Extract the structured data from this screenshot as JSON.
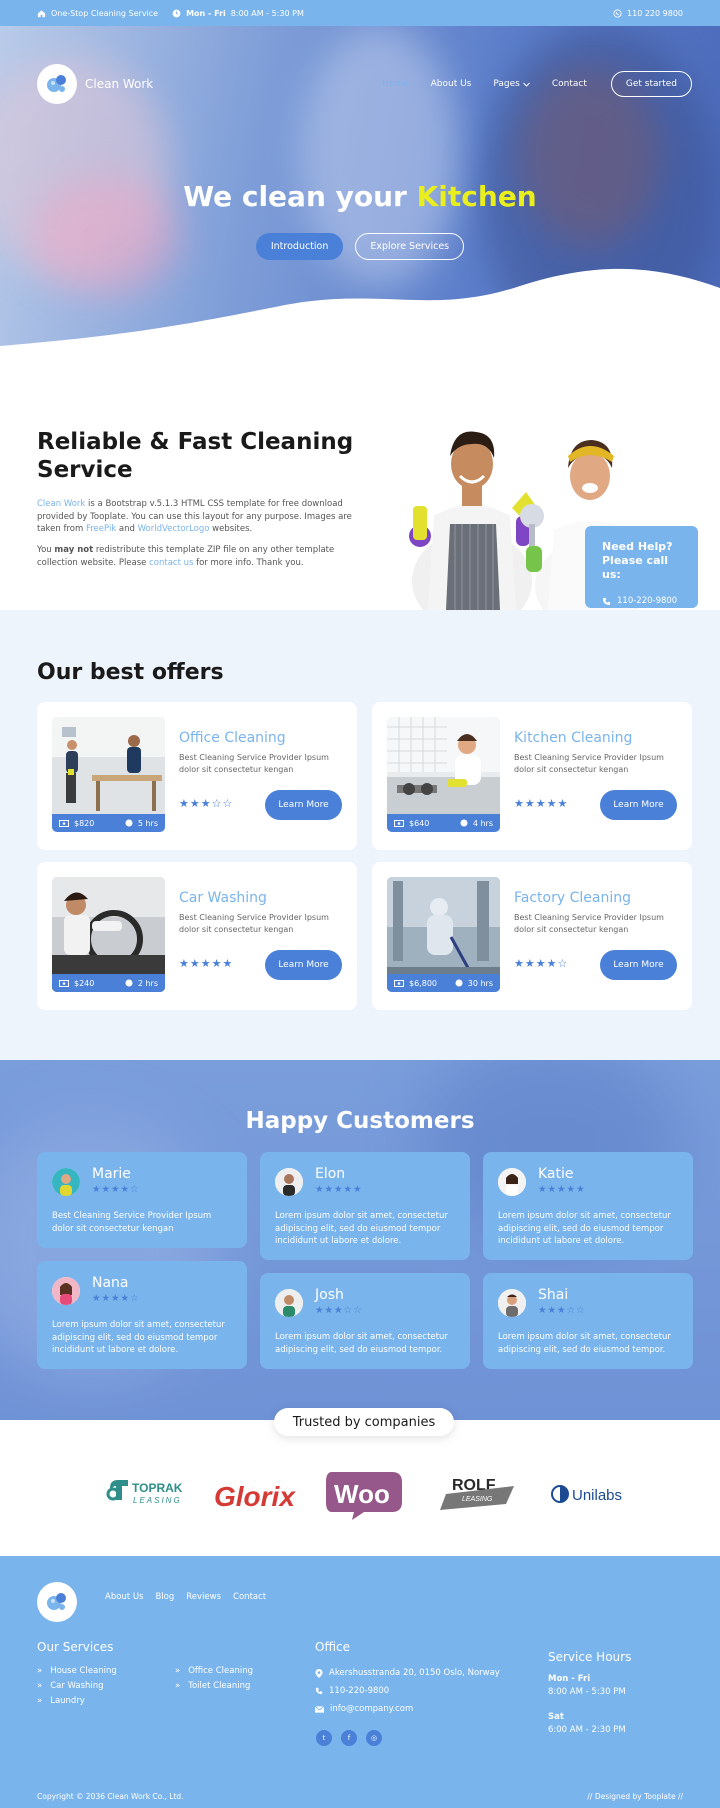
{
  "topbar": {
    "service": "One-Stop Cleaning Service",
    "days": "Mon - Fri",
    "hours": "8:00 AM - 5:30 PM",
    "phone": "110 220 9800"
  },
  "nav": {
    "brand": "Clean Work",
    "links": [
      "Home",
      "About Us",
      "Pages",
      "Contact"
    ],
    "cta": "Get started"
  },
  "hero": {
    "title_a": "We clean your",
    "title_b": "Kitchen",
    "btn_intro": "Introduction",
    "btn_explore": "Explore Services"
  },
  "about": {
    "title": "Reliable & Fast Cleaning Service",
    "p1_a": "Clean Work",
    "p1_b": " is a Bootstrap v.5.1.3 HTML CSS template for free download provided by Tooplate. You can use this layout for any purpose. Images are taken from ",
    "p1_c": "FreePik",
    "p1_d": " and ",
    "p1_e": "WorldVectorLogo",
    "p1_f": " websites.",
    "p2_a": "You ",
    "p2_b": "may not",
    "p2_c": " redistribute this template ZIP file on any other template collection website. Please ",
    "p2_d": "contact us",
    "p2_e": " for more info. Thank you.",
    "help_title": "Need Help? Please call us:",
    "help_phone": "110-220-9800"
  },
  "offers": {
    "title": "Our best offers",
    "learn": "Learn More",
    "cards": [
      {
        "title": "Office Cleaning",
        "desc": "Best Cleaning Service Provider Ipsum dolor sit consectetur kengan",
        "price": "$820",
        "time": "5 hrs",
        "stars": "★★★☆☆"
      },
      {
        "title": "Kitchen Cleaning",
        "desc": "Best Cleaning Service Provider Ipsum dolor sit consectetur kengan",
        "price": "$640",
        "time": "4 hrs",
        "stars": "★★★★★"
      },
      {
        "title": "Car Washing",
        "desc": "Best Cleaning Service Provider Ipsum dolor sit consectetur kengan",
        "price": "$240",
        "time": "2 hrs",
        "stars": "★★★★★"
      },
      {
        "title": "Factory Cleaning",
        "desc": "Best Cleaning Service Provider Ipsum dolor sit consectetur kengan",
        "price": "$6,800",
        "time": "30 hrs",
        "stars": "★★★★☆"
      }
    ]
  },
  "customers": {
    "title": "Happy Customers",
    "list": [
      {
        "name": "Marie",
        "stars": "★★★★☆",
        "text": "Best Cleaning Service Provider Ipsum dolor sit consectetur kengan"
      },
      {
        "name": "Elon",
        "stars": "★★★★★",
        "text": "Lorem ipsum dolor sit amet, consectetur adipiscing elit, sed do eiusmod tempor incididunt ut labore et dolore."
      },
      {
        "name": "Katie",
        "stars": "★★★★★",
        "text": "Lorem ipsum dolor sit amet, consectetur adipiscing elit, sed do eiusmod tempor incididunt ut labore et dolore."
      },
      {
        "name": "Nana",
        "stars": "★★★★☆",
        "text": "Lorem ipsum dolor sit amet, consectetur adipiscing elit, sed do eiusmod tempor incididunt ut labore et dolore."
      },
      {
        "name": "Josh",
        "stars": "★★★☆☆",
        "text": "Lorem ipsum dolor sit amet, consectetur adipiscing elit, sed do eiusmod tempor."
      },
      {
        "name": "Shai",
        "stars": "★★★☆☆",
        "text": "Lorem ipsum dolor sit amet, consectetur adipiscing elit, sed do eiusmod tempor."
      }
    ]
  },
  "trusted": {
    "title": "Trusted by companies",
    "logos": [
      "TOPRAK",
      "LEASING",
      "Glorix",
      "Woo",
      "ROLF",
      "LEASING",
      "Unilabs"
    ]
  },
  "footer": {
    "links": [
      "About Us",
      "Blog",
      "Reviews",
      "Contact"
    ],
    "services_title": "Our Services",
    "services_col1": [
      "House Cleaning",
      "Car Washing",
      "Laundry"
    ],
    "services_col2": [
      "Office Cleaning",
      "Toilet Cleaning"
    ],
    "office_title": "Office",
    "address": "Akershusstranda 20, 0150 Oslo, Norway",
    "phone": "110-220-9800",
    "email": "info@company.com",
    "hours_title": "Service Hours",
    "hours_days1": "Mon - Fri",
    "hours_time1": "8:00 AM - 5:30 PM",
    "hours_days2": "Sat",
    "hours_time2": "6:00 AM - 2:30 PM",
    "copyright": "Copyright © 2036 Clean Work Co., Ltd.",
    "designed": "// Designed by Tooplate //"
  },
  "colors": {
    "primary": "#7ab4ec",
    "accent": "#4a80d8",
    "highlight": "#e9ef1d"
  }
}
